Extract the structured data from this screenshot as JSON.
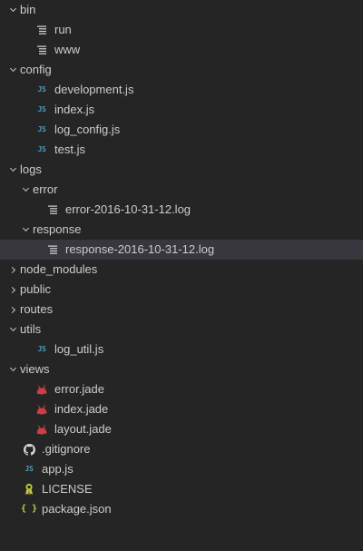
{
  "explorer": {
    "items": [
      {
        "label": "bin",
        "kind": "folder",
        "open": true,
        "depth": 0
      },
      {
        "label": "run",
        "kind": "text",
        "depth": 1
      },
      {
        "label": "www",
        "kind": "text",
        "depth": 1
      },
      {
        "label": "config",
        "kind": "folder",
        "open": true,
        "depth": 0
      },
      {
        "label": "development.js",
        "kind": "js",
        "depth": 1
      },
      {
        "label": "index.js",
        "kind": "js",
        "depth": 1
      },
      {
        "label": "log_config.js",
        "kind": "js",
        "depth": 1
      },
      {
        "label": "test.js",
        "kind": "js",
        "depth": 1
      },
      {
        "label": "logs",
        "kind": "folder",
        "open": true,
        "depth": 0
      },
      {
        "label": "error",
        "kind": "folder",
        "open": true,
        "depth": 1
      },
      {
        "label": "error-2016-10-31-12.log",
        "kind": "text",
        "depth": 2
      },
      {
        "label": "response",
        "kind": "folder",
        "open": true,
        "depth": 1
      },
      {
        "label": "response-2016-10-31-12.log",
        "kind": "text",
        "depth": 2,
        "selected": true
      },
      {
        "label": "node_modules",
        "kind": "folder",
        "open": false,
        "depth": 0
      },
      {
        "label": "public",
        "kind": "folder",
        "open": false,
        "depth": 0
      },
      {
        "label": "routes",
        "kind": "folder",
        "open": false,
        "depth": 0
      },
      {
        "label": "utils",
        "kind": "folder",
        "open": true,
        "depth": 0
      },
      {
        "label": "log_util.js",
        "kind": "js",
        "depth": 1
      },
      {
        "label": "views",
        "kind": "folder",
        "open": true,
        "depth": 0
      },
      {
        "label": "error.jade",
        "kind": "jade",
        "depth": 1
      },
      {
        "label": "index.jade",
        "kind": "jade",
        "depth": 1
      },
      {
        "label": "layout.jade",
        "kind": "jade",
        "depth": 1
      },
      {
        "label": ".gitignore",
        "kind": "git",
        "depth": 0
      },
      {
        "label": "app.js",
        "kind": "js",
        "depth": 0
      },
      {
        "label": "LICENSE",
        "kind": "license",
        "depth": 0
      },
      {
        "label": "package.json",
        "kind": "json",
        "depth": 0
      }
    ],
    "icon_glyphs": {
      "js": "JS",
      "json": "{ }"
    },
    "colors": {
      "background": "#252526",
      "selected_row": "#37373d",
      "text": "#cccccc",
      "js_icon": "#519aba",
      "jade_icon": "#cc3e44",
      "json_icon": "#cbcb41",
      "license_icon": "#cbcb41",
      "git_icon": "#d4d7d6",
      "text_file_icon": "#d4d7d6"
    }
  }
}
